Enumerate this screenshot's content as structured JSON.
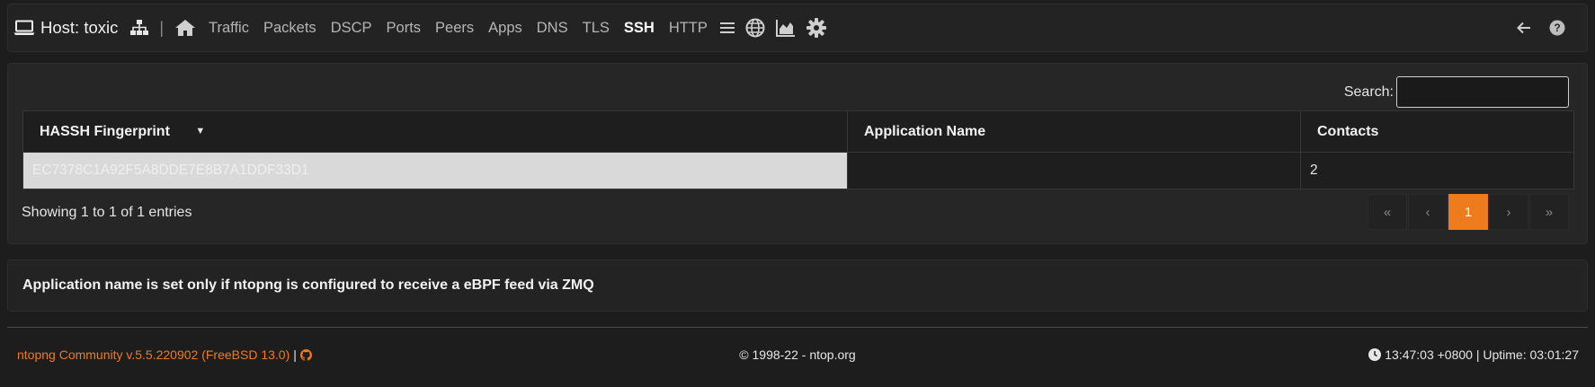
{
  "header": {
    "host_label": "Host: toxic",
    "separator": "|",
    "nav_items": [
      "Traffic",
      "Packets",
      "DSCP",
      "Ports",
      "Peers",
      "Apps",
      "DNS",
      "TLS",
      "SSH",
      "HTTP"
    ],
    "active_item": "SSH",
    "icons": [
      "laptop-icon",
      "sitemap-icon",
      "home-icon",
      "list-icon",
      "globe-icon",
      "area-chart-icon",
      "gear-icon",
      "back-arrow-icon",
      "help-icon"
    ]
  },
  "search": {
    "label": "Search:",
    "value": ""
  },
  "table": {
    "columns": [
      "HASSH Fingerprint",
      "Application Name",
      "Contacts"
    ],
    "sort_indicator": "▼",
    "rows": [
      {
        "fingerprint": "EC7378C1A92F5A8DDE7E8B7A1DDF33D1",
        "application": "",
        "contacts": "2"
      }
    ]
  },
  "showing": "Showing 1 to 1 of 1 entries",
  "pagination": {
    "first": "«",
    "prev": "‹",
    "current": "1",
    "next": "›",
    "last": "»"
  },
  "note": "Application name is set only if ntopng is configured to receive a eBPF feed via ZMQ",
  "footer": {
    "version": "ntopng Community v.5.5.220902 (FreeBSD 13.0)",
    "pipe": "|",
    "copyright": "© 1998-22 - ntop.org",
    "time": "13:47:03 +0800 | Uptime: 03:01:27"
  },
  "colors": {
    "accent": "#ee7b1c",
    "background": "#1d1d1d",
    "panel": "#262626"
  }
}
